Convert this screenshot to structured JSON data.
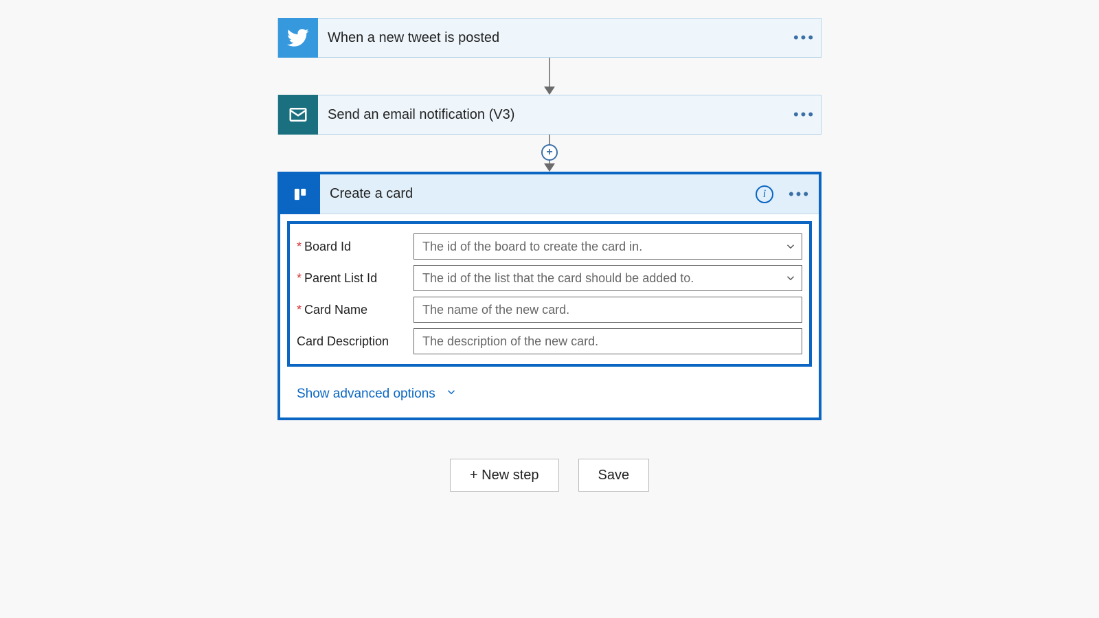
{
  "steps": {
    "trigger": {
      "title": "When a new tweet is posted"
    },
    "email": {
      "title": "Send an email notification (V3)"
    },
    "trello": {
      "title": "Create a card"
    }
  },
  "form": {
    "board_id": {
      "label": "Board Id",
      "placeholder": "The id of the board to create the card in."
    },
    "parent_list_id": {
      "label": "Parent List Id",
      "placeholder": "The id of the list that the card should be added to."
    },
    "card_name": {
      "label": "Card Name",
      "placeholder": "The name of the new card."
    },
    "card_description": {
      "label": "Card Description",
      "placeholder": "The description of the new card."
    }
  },
  "advanced_label": "Show advanced options",
  "buttons": {
    "new_step": "+ New step",
    "save": "Save"
  },
  "colors": {
    "twitter": "#3799dd",
    "email": "#125f6f",
    "trello": "#0a66c2"
  }
}
